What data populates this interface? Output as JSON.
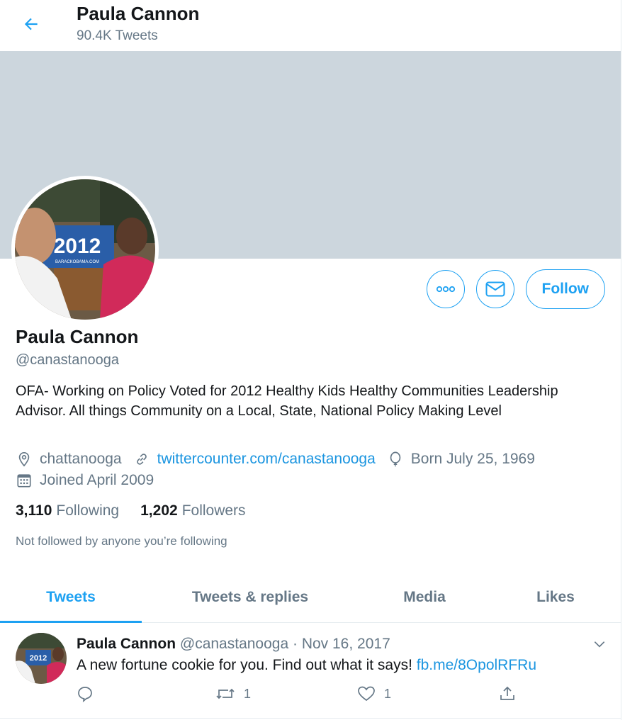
{
  "header": {
    "name": "Paula Cannon",
    "tweet_count": "90.4K Tweets"
  },
  "profile": {
    "name": "Paula Cannon",
    "handle": "@canastanooga",
    "bio": "OFA- Working on Policy Voted for 2012 Healthy Kids Healthy Communities Leadership Advisor. All things Community on a Local, State, National Policy Making Level",
    "location": "chattanooga",
    "website": "twittercounter.com/canastanooga",
    "birthday": "Born July 25, 1969",
    "joined": "Joined April 2009",
    "following_count": "3,110",
    "following_label": "Following",
    "followers_count": "1,202",
    "followers_label": "Followers",
    "not_followed": "Not followed by anyone you’re following",
    "avatar_sign_text": "2012",
    "avatar_sign_sub": "BARACKOBAMA.COM"
  },
  "actions": {
    "follow_label": "Follow"
  },
  "tabs": [
    {
      "label": "Tweets",
      "active": true
    },
    {
      "label": "Tweets & replies",
      "active": false
    },
    {
      "label": "Media",
      "active": false
    },
    {
      "label": "Likes",
      "active": false
    }
  ],
  "tweet": {
    "author_name": "Paula Cannon",
    "author_handle": "@canastanooga",
    "separator": "·",
    "date": "Nov 16, 2017",
    "text": "A new fortune cookie for you. Find out what it says!",
    "link": "fb.me/8OpolRFRu",
    "retweets": "1",
    "likes": "1"
  },
  "colors": {
    "accent": "#1da1f2",
    "banner": "#ccd6dd",
    "secondary_text": "#657786"
  }
}
